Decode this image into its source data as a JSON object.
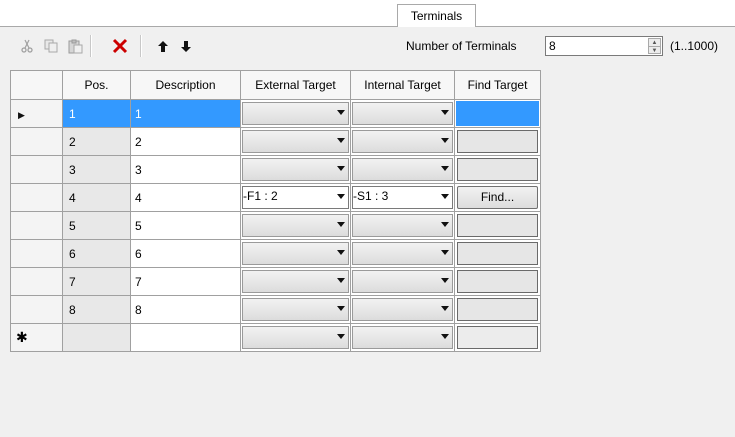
{
  "tab": {
    "label": "Terminals"
  },
  "toolbar": {
    "icons": [
      "cut-icon",
      "copy-icon",
      "paste-icon",
      "delete-icon",
      "move-up-icon",
      "move-down-icon"
    ],
    "num_label": "Number of Terminals",
    "num_value": "8",
    "range": "(1..1000)"
  },
  "grid": {
    "headers": [
      "Pos.",
      "Description",
      "External Target",
      "Internal Target",
      "Find Target"
    ],
    "rows": [
      {
        "pos": "1",
        "desc": "1",
        "ext": "",
        "int": "",
        "find": ""
      },
      {
        "pos": "2",
        "desc": "2",
        "ext": "",
        "int": "",
        "find": ""
      },
      {
        "pos": "3",
        "desc": "3",
        "ext": "",
        "int": "",
        "find": ""
      },
      {
        "pos": "4",
        "desc": "4",
        "ext": "-F1 : 2",
        "int": "-S1 : 3",
        "find": "Find..."
      },
      {
        "pos": "5",
        "desc": "5",
        "ext": "",
        "int": "",
        "find": ""
      },
      {
        "pos": "6",
        "desc": "6",
        "ext": "",
        "int": "",
        "find": ""
      },
      {
        "pos": "7",
        "desc": "7",
        "ext": "",
        "int": "",
        "find": ""
      },
      {
        "pos": "8",
        "desc": "8",
        "ext": "",
        "int": "",
        "find": ""
      }
    ],
    "new_row_marker": "✱",
    "current_row_marker": "▶"
  },
  "colors": {
    "selection": "#3399ff",
    "delete": "#cc0000"
  }
}
